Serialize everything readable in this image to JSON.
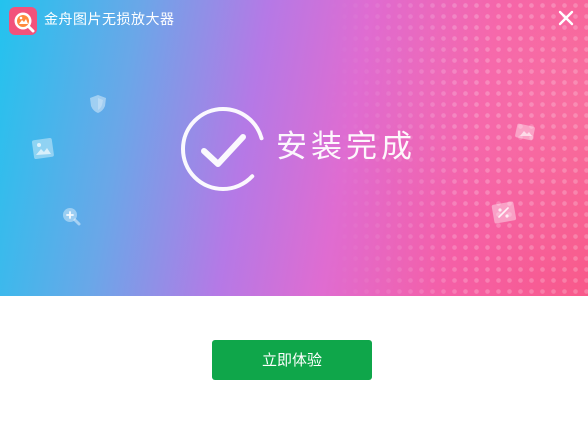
{
  "window": {
    "title": "金舟图片无损放大器",
    "close_label": "close"
  },
  "banner": {
    "status_text": "安装完成",
    "decorative_icons": [
      "shield-icon",
      "image-icon",
      "zoom-in-icon",
      "photo-icon",
      "edit-image-icon"
    ]
  },
  "footer": {
    "start_button_label": "立即体验"
  },
  "colors": {
    "gradient_start": "#23c3ee",
    "gradient_middle": "#df6cd1",
    "gradient_end": "#f85a8a",
    "button": "#0fa64a",
    "text_on_banner": "#ffffff"
  }
}
